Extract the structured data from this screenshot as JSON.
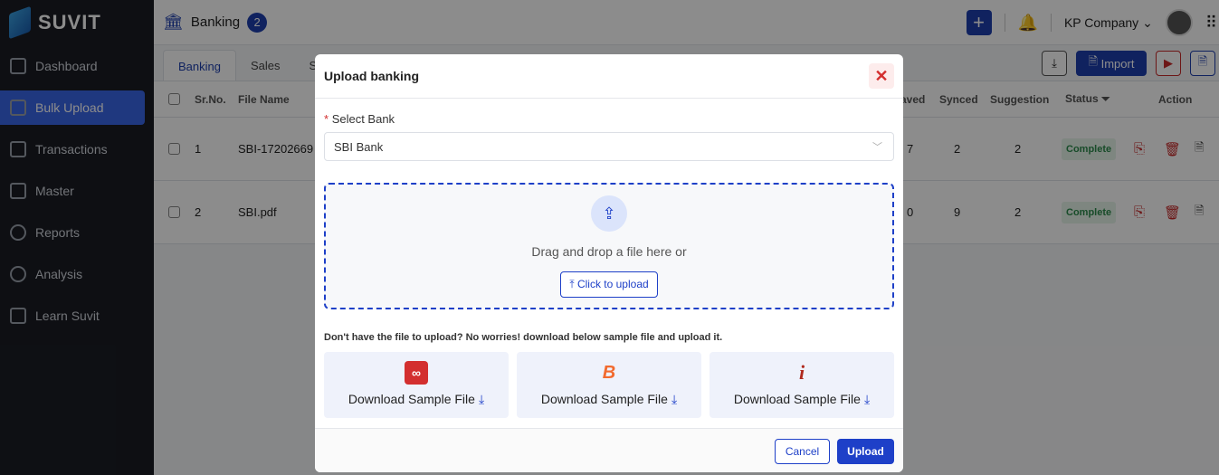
{
  "brand": "SUVIT",
  "sidebar": {
    "items": [
      {
        "label": "Dashboard"
      },
      {
        "label": "Bulk Upload",
        "active": true
      },
      {
        "label": "Transactions"
      },
      {
        "label": "Master"
      },
      {
        "label": "Reports"
      },
      {
        "label": "Analysis"
      },
      {
        "label": "Learn Suvit"
      }
    ]
  },
  "header": {
    "title": "Banking",
    "count": "2",
    "company": "KP Company"
  },
  "tabs": [
    "Banking",
    "Sales",
    "Sa"
  ],
  "toolbar": {
    "import": "Import"
  },
  "table": {
    "headers": [
      "Sr.No.",
      "File Name",
      "aved",
      "Synced",
      "Suggestion",
      "Status",
      "Action"
    ],
    "rows": [
      {
        "sr": "1",
        "file": "SBI-17202669",
        "saved": "7",
        "synced": "2",
        "suggestion": "2",
        "status": "Complete"
      },
      {
        "sr": "2",
        "file": "SBI.pdf",
        "saved": "0",
        "synced": "9",
        "suggestion": "2",
        "status": "Complete"
      }
    ]
  },
  "modal": {
    "title": "Upload banking",
    "select_label": "Select Bank",
    "select_value": "SBI Bank",
    "drop_text": "Drag and drop a file here or",
    "click_upload": "Click to upload",
    "note": "Don't have the file to upload? No worries! download below sample file and upload it.",
    "cards": [
      {
        "label": "Download Sample File",
        "bank_icon": "kotak-logo",
        "color": "#d32f2f"
      },
      {
        "label": "Download Sample File",
        "bank_icon": "bank-of-baroda-logo",
        "color": "#f26a2e"
      },
      {
        "label": "Download Sample File",
        "bank_icon": "icici-logo",
        "color": "#b02a1e"
      }
    ],
    "cancel": "Cancel",
    "upload": "Upload"
  },
  "colors": {
    "primary": "#1e40c8",
    "danger": "#d32f2f",
    "success": "#2c8a4c"
  }
}
